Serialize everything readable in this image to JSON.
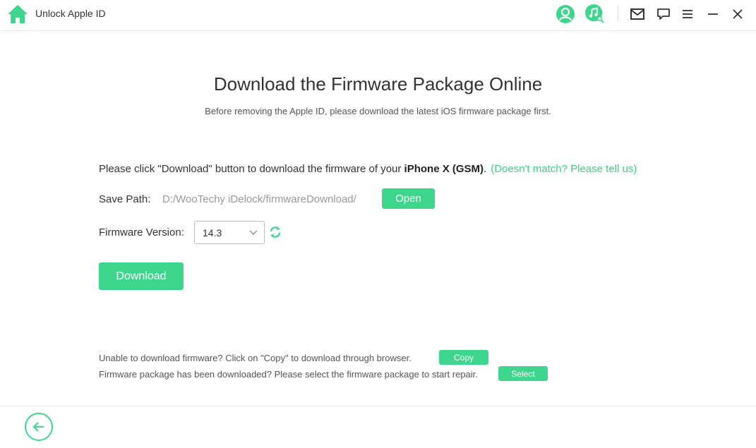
{
  "window": {
    "title": "Unlock Apple ID",
    "icons": [
      "home-icon",
      "account-icon",
      "music-search-icon",
      "mail-icon",
      "feedback-icon",
      "menu-icon",
      "minimize-icon",
      "close-icon"
    ]
  },
  "main": {
    "heading": "Download the Firmware Package Online",
    "subheading": "Before removing the Apple ID, please download the latest iOS firmware package first.",
    "instruction_prefix": "Please click \"Download\" button to download the firmware of your ",
    "device_model": "iPhone X (GSM)",
    "instruction_suffix": ".",
    "mismatch_link": "(Doesn't match? Please tell us)",
    "save_path_label": "Save Path:",
    "save_path_value": "D:/WooTechy iDelock/firmwareDownload/",
    "open_button": "Open",
    "firmware_version_label": "Firmware Version:",
    "firmware_version_selected": "14.3",
    "download_button": "Download"
  },
  "help": {
    "copy_text": "Unable to download firmware? Click on \"Copy\" to download through browser.",
    "copy_button": "Copy",
    "select_text": "Firmware package has been downloaded? Please select the firmware package to start repair.",
    "select_button": "Select"
  },
  "colors": {
    "accent": "#3dd68c",
    "link": "#3dcf85",
    "text": "#333333",
    "muted": "#999999"
  }
}
